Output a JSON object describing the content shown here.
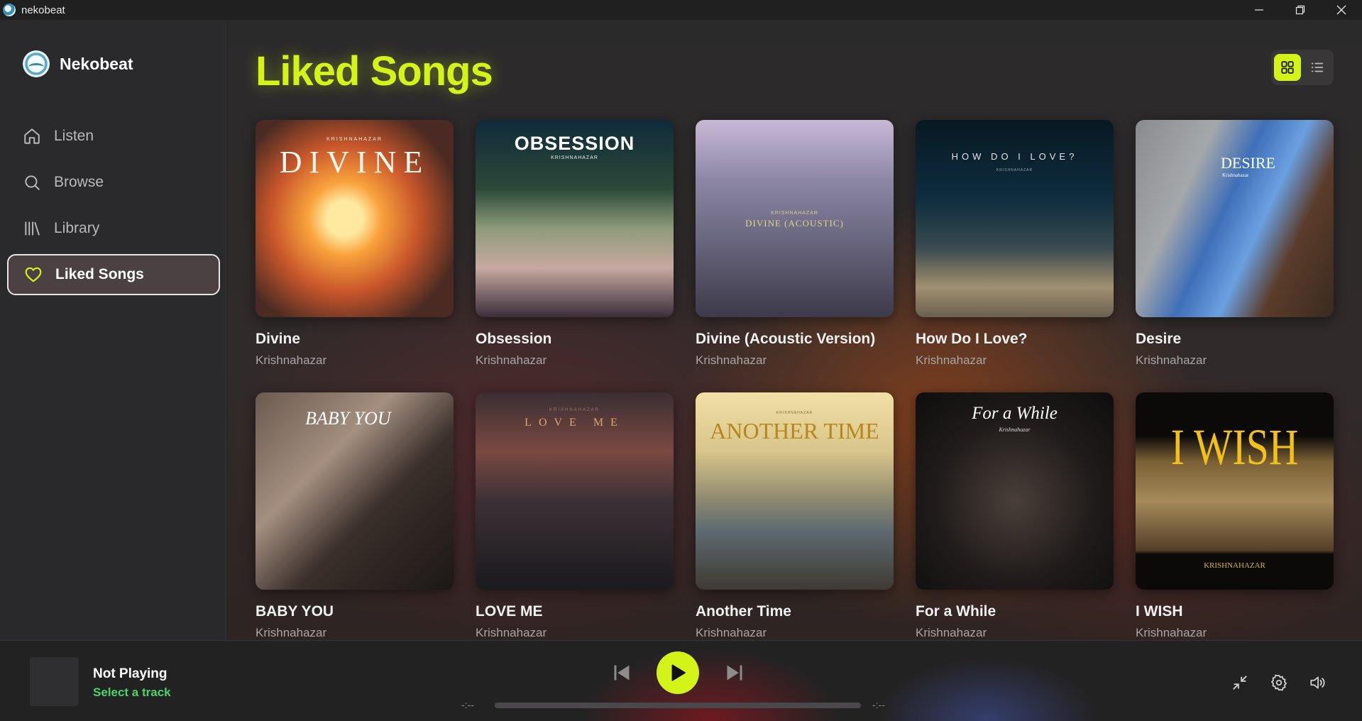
{
  "window": {
    "title": "nekobeat",
    "minimize": "—",
    "restore": "❐",
    "close": "✕"
  },
  "sidebar": {
    "brand": "Nekobeat",
    "items": [
      {
        "label": "Listen",
        "icon": "home-icon"
      },
      {
        "label": "Browse",
        "icon": "search-icon"
      },
      {
        "label": "Library",
        "icon": "library-icon"
      },
      {
        "label": "Liked Songs",
        "icon": "heart-icon",
        "active": true
      }
    ]
  },
  "main": {
    "title": "Liked Songs",
    "view_mode": "grid",
    "songs": [
      {
        "title": "Divine",
        "artist": "Krishnahazar",
        "cover_text": "DIVINE",
        "cover_small": "KRISHNAHAZAR"
      },
      {
        "title": "Obsession",
        "artist": "Krishnahazar",
        "cover_text": "OBSESSION",
        "cover_small": "KRISHNAHAZAR"
      },
      {
        "title": "Divine (Acoustic Version)",
        "artist": "Krishnahazar",
        "cover_text": "DIVINE (ACOUSTIC)",
        "cover_small": "KRISHNAHAZAR"
      },
      {
        "title": "How Do I Love?",
        "artist": "Krishnahazar",
        "cover_text": "HOW DO I LOVE?",
        "cover_small": "KRISHNAHAZAR"
      },
      {
        "title": "Desire",
        "artist": "Krishnahazar",
        "cover_text": "DESIRE",
        "cover_small": "Krishnahazar"
      },
      {
        "title": "BABY YOU",
        "artist": "Krishnahazar",
        "cover_text": "BABY YOU",
        "cover_small": ""
      },
      {
        "title": "LOVE ME",
        "artist": "Krishnahazar",
        "cover_text": "LOVE ME",
        "cover_small": "KRISHNAHAZAR"
      },
      {
        "title": "Another Time",
        "artist": "Krishnahazar",
        "cover_text": "ANOTHER TIME",
        "cover_small": "KRISHNAHAZAR"
      },
      {
        "title": "For a While",
        "artist": "Krishnahazar",
        "cover_text": "For a While",
        "cover_small": "Krishnahazar"
      },
      {
        "title": "I WISH",
        "artist": "Krishnahazar",
        "cover_text": "I WISH",
        "cover_small": "KRISHNAHAZAR"
      }
    ]
  },
  "player": {
    "title": "Not Playing",
    "subtitle": "Select a track",
    "time_elapsed": "-:--",
    "time_total": "-:--",
    "progress": 0
  },
  "colors": {
    "accent": "#d4f319",
    "subtitle_green": "#4ed26a",
    "sidebar_bg": "#2a2a2c"
  }
}
